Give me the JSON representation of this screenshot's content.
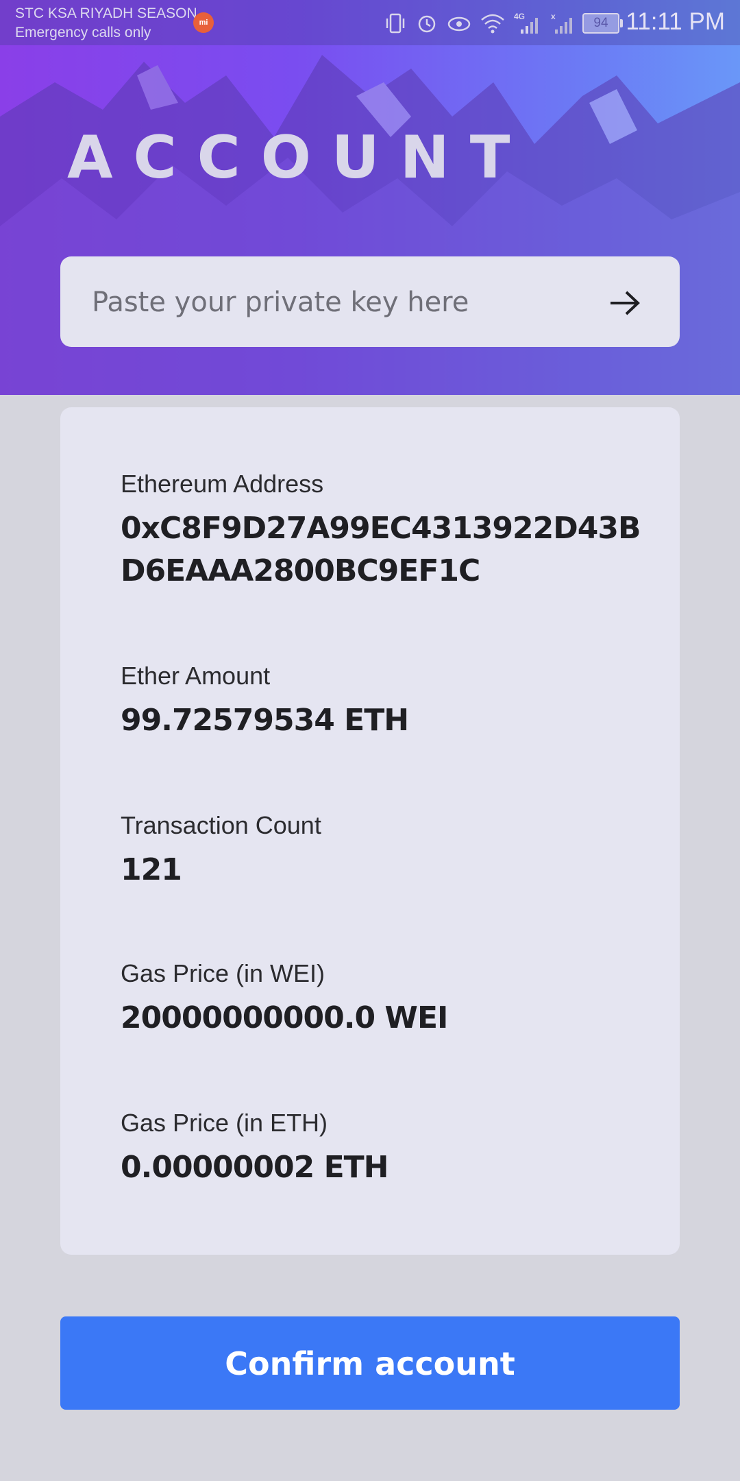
{
  "status_bar": {
    "carrier": "STC KSA RIYADH SEASON",
    "network_note": "Emergency calls only",
    "app_badge": "mi",
    "network_type": "4G",
    "battery": "94",
    "time": "11:11 PM",
    "icons": [
      "vibrate-icon",
      "alarm-icon",
      "eye-comfort-icon",
      "wifi-icon",
      "signal-icon",
      "signal-no-sim-icon",
      "battery-icon"
    ]
  },
  "header": {
    "title": "ACCOUNT",
    "gradient_start": "#8a3fe8",
    "gradient_end": "#6a97f8"
  },
  "key_input": {
    "placeholder": "Paste your private key here",
    "value": "",
    "submit_icon": "arrow-right-icon"
  },
  "account": {
    "address_label": "Ethereum Address",
    "address": "0xC8F9D27A99EC4313922D43BD6EAAA2800BC9EF1C",
    "ether_label": "Ether Amount",
    "ether": "99.72579534 ETH",
    "tx_label": "Transaction Count",
    "tx_count": "121",
    "gas_wei_label": "Gas Price (in WEI)",
    "gas_wei": "20000000000.0 WEI",
    "gas_eth_label": "Gas Price (in ETH)",
    "gas_eth": "0.00000002 ETH"
  },
  "confirm": {
    "label": "Confirm account",
    "color": "#3b78f6"
  }
}
